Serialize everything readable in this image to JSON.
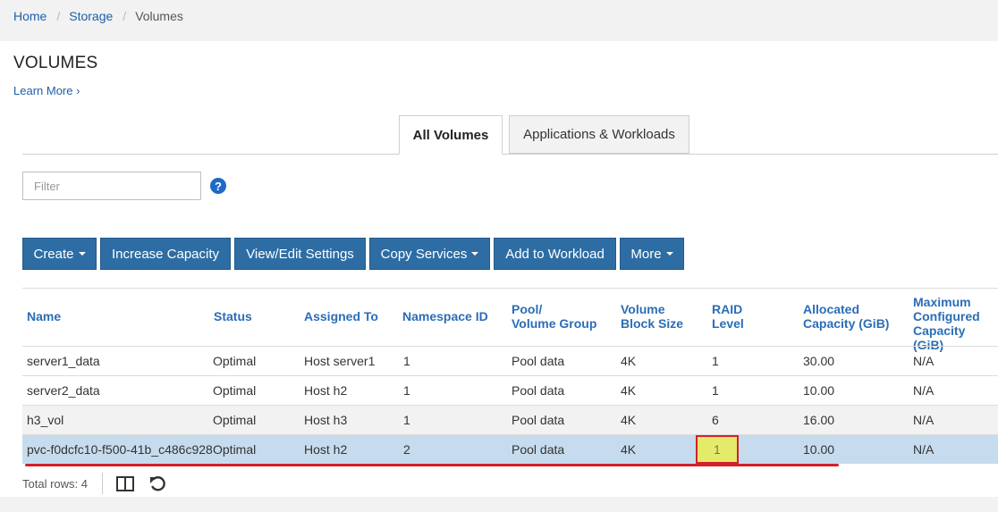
{
  "breadcrumb": [
    "Home",
    "Storage",
    "Volumes"
  ],
  "page_title": "VOLUMES",
  "learn_more": "Learn More ›",
  "tabs": [
    {
      "label": "All Volumes",
      "active": true
    },
    {
      "label": "Applications & Workloads",
      "active": false
    }
  ],
  "filter": {
    "placeholder": "Filter",
    "value": ""
  },
  "help_icon": "question-circle-icon",
  "toolbar": {
    "create": "Create",
    "increase_capacity": "Increase Capacity",
    "view_edit": "View/Edit Settings",
    "copy_services": "Copy Services",
    "add_workload": "Add to Workload",
    "more": "More"
  },
  "table": {
    "headers": {
      "name": "Name",
      "status": "Status",
      "assigned_to": "Assigned To",
      "namespace_id": "Namespace ID",
      "pool_1": "Pool/",
      "pool_2": "Volume Group",
      "block_1": "Volume",
      "block_2": "Block Size",
      "raid_1": "RAID",
      "raid_2": "Level",
      "alloc_1": "Allocated",
      "alloc_2": "Capacity (GiB)",
      "max_1": "Maximum",
      "max_2": "Configured",
      "max_3": "Capacity (GiB)"
    },
    "rows": [
      {
        "name": "server1_data",
        "status": "Optimal",
        "assigned_to": "Host server1",
        "namespace_id": "1",
        "pool": "Pool data",
        "block_size": "4K",
        "raid": "1",
        "allocated": "30.00",
        "max": "N/A"
      },
      {
        "name": "server2_data",
        "status": "Optimal",
        "assigned_to": "Host h2",
        "namespace_id": "1",
        "pool": "Pool data",
        "block_size": "4K",
        "raid": "1",
        "allocated": "10.00",
        "max": "N/A"
      },
      {
        "name": "h3_vol",
        "status": "Optimal",
        "assigned_to": "Host h3",
        "namespace_id": "1",
        "pool": "Pool data",
        "block_size": "4K",
        "raid": "6",
        "allocated": "16.00",
        "max": "N/A"
      },
      {
        "name": "pvc-f0dcfc10-f500-41b_c486c928",
        "status": "Optimal",
        "assigned_to": "Host h2",
        "namespace_id": "2",
        "pool": "Pool data",
        "block_size": "4K",
        "raid": "1",
        "allocated": "10.00",
        "max": "N/A"
      }
    ],
    "selected_row": 3,
    "total_rows": "Total rows: 4"
  },
  "colors": {
    "accent_blue": "#2e6da4",
    "link_blue": "#1f5ea8",
    "selected_row": "#c6dcee",
    "highlight_fill": "#e4ea6a",
    "annotation_red": "#d3202a"
  },
  "footer_icons": [
    "columns-icon",
    "refresh-icon"
  ]
}
